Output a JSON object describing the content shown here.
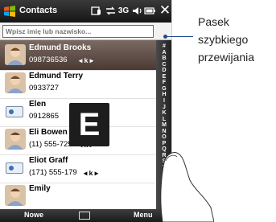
{
  "titlebar": {
    "title": "Contacts",
    "start_icon": "windows-flag-icon",
    "status_icons": [
      "connectivity-icon",
      "sync-icon",
      "signal-3g-icon",
      "volume-icon",
      "battery-icon"
    ],
    "signal_text": "3G",
    "close_glyph": "✕"
  },
  "search": {
    "placeholder": "Wpisz imię lub nazwisko..."
  },
  "contacts": [
    {
      "name": "Edmund Brooks",
      "phone": "098736536",
      "type": "k",
      "avatar": "photo",
      "selected": true
    },
    {
      "name": "Edmund Terry",
      "phone": "0933727",
      "type": "",
      "avatar": "photo",
      "selected": false
    },
    {
      "name": "Elen",
      "phone": "0912865",
      "type": "",
      "avatar": "card",
      "selected": false
    },
    {
      "name": "Eli Bowen",
      "phone": "(11) 555-725",
      "type": "k",
      "avatar": "photo",
      "selected": false
    },
    {
      "name": "Eliot Graff",
      "phone": "(171) 555-179",
      "type": "k",
      "avatar": "card",
      "selected": false
    },
    {
      "name": "Emily",
      "phone": "",
      "type": "",
      "avatar": "photo",
      "selected": false
    }
  ],
  "alphabet": [
    "#",
    "A",
    "B",
    "C",
    "D",
    "E",
    "F",
    "G",
    "H",
    "I",
    "J",
    "K",
    "L",
    "M",
    "N",
    "O",
    "P",
    "Q",
    "R",
    "S",
    "T",
    "U",
    "V",
    "W",
    "X",
    "Y",
    "Z"
  ],
  "popup_letter": "E",
  "menubar": {
    "left": "Nowe",
    "right": "Menu"
  },
  "callout": {
    "lines": [
      "Pasek",
      "szybkiego",
      "przewijania"
    ]
  },
  "colors": {
    "selection": "#5e4e46",
    "callout": "#1f4a8c",
    "bars": "#1e1e1e"
  }
}
